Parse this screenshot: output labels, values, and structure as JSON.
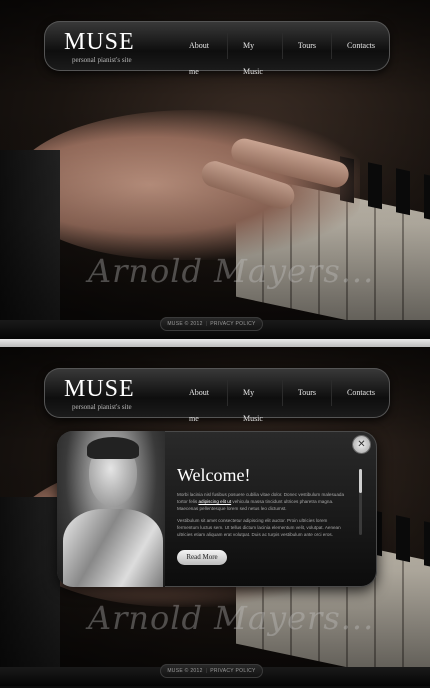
{
  "site": {
    "logo": "MUSE",
    "tagline": "personal pianist's site",
    "signature": "Arnold Mayers..."
  },
  "nav": {
    "items": [
      {
        "label": "About me"
      },
      {
        "label": "My Music"
      },
      {
        "label": "Tours"
      },
      {
        "label": "Contacts"
      }
    ]
  },
  "footer": {
    "copyright": "MUSE © 2012",
    "privacy_link": "PRIVACY POLICY"
  },
  "modal": {
    "title": "Welcome!",
    "paragraph1_before": "Morbi lacinia nisl fusibus posuere cubilia vitae dolor. Donec vestibulum malesuada tortor felis",
    "paragraph1_link": "adipiscing elit ut",
    "paragraph1_after": "vehicula massa tincidunt ultrices pharetra magna. Maecenas pellentesque lorem sed netus leo dictumst.",
    "paragraph2": "Vestibulum sit amet consectetur adipiscing elit auctor. Proin ultricies lorem fermentum luctus sem. Ut tellus dictum lacinia elementum velit, volutpat. Aenean ultricies etiam aliquam erat volutpat. Duis ac turpis vestibulum ante orci eros.",
    "read_more": "Read More",
    "close": "✕",
    "scroll_position": 0
  }
}
